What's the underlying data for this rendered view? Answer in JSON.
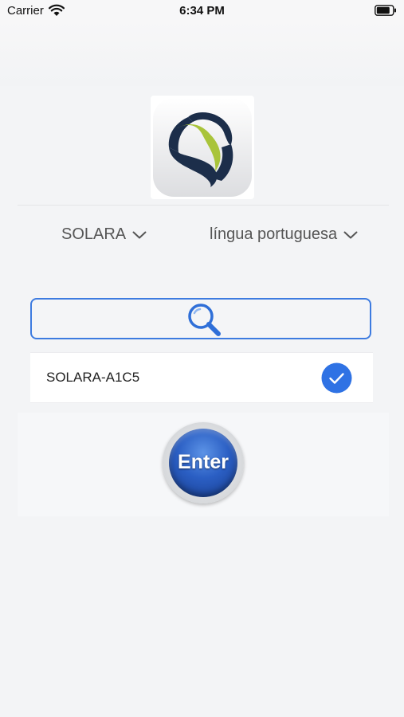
{
  "status_bar": {
    "carrier": "Carrier",
    "time": "6:34 PM"
  },
  "header": {
    "logo_icon": "solara-s-logo-icon"
  },
  "selectors": {
    "device": {
      "label": "SOLARA",
      "icon": "chevron-down-icon"
    },
    "language": {
      "label": "língua portuguesa",
      "icon": "chevron-down-icon"
    }
  },
  "search": {
    "icon": "search-icon",
    "placeholder": ""
  },
  "devices": [
    {
      "name": "SOLARA-A1C5",
      "selected": true,
      "icon": "check-circle-icon"
    }
  ],
  "enter_button": {
    "label": "Enter"
  },
  "colors": {
    "accent": "#3d7be0",
    "check": "#2f72e4",
    "background": "#f3f4f6"
  }
}
